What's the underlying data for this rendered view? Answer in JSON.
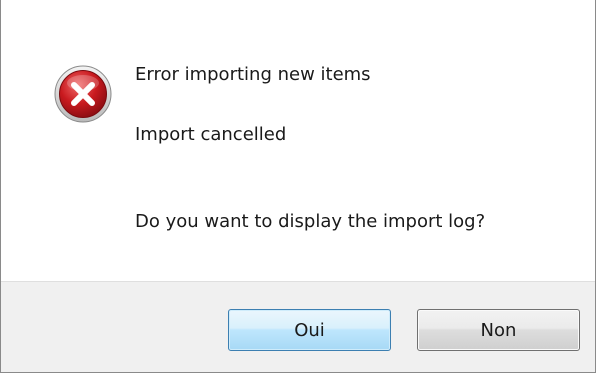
{
  "dialog": {
    "icon": "error-icon",
    "title_message": "Error importing new items",
    "detail_message": "Import cancelled",
    "question": "Do you want to display the import log?",
    "buttons": {
      "yes_label": "Oui",
      "no_label": "Non"
    }
  },
  "colors": {
    "error_red": "#c4141c",
    "default_button_border": "#3c7fb1",
    "footer_background": "#f0f0f0"
  }
}
